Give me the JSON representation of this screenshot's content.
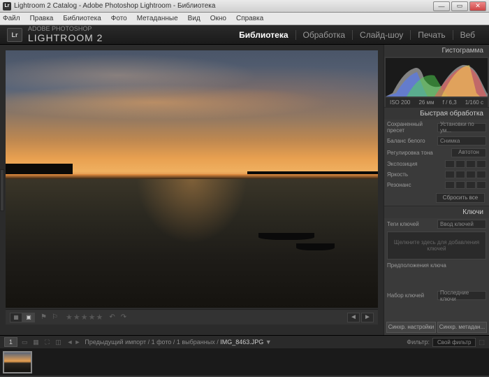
{
  "titlebar": {
    "text": "Lightroom 2 Catalog - Adobe Photoshop Lightroom - Библиотека",
    "logo": "Lr"
  },
  "menubar": {
    "items": [
      "Файл",
      "Правка",
      "Библиотека",
      "Фото",
      "Метаданные",
      "Вид",
      "Окно",
      "Справка"
    ]
  },
  "header": {
    "logo": "Lr",
    "brand_top": "ADOBE PHOTOSHOP",
    "brand_main": "LIGHTROOM 2",
    "modules": [
      "Библиотека",
      "Обработка",
      "Слайд-шоу",
      "Печать",
      "Веб"
    ]
  },
  "right": {
    "histogram_title": "Гистограмма",
    "histo_info": {
      "iso": "ISO 200",
      "focal": "26 мм",
      "aperture": "f / 6,3",
      "shutter": "1/160 с"
    },
    "quick_dev": {
      "title": "Быстрая обработка",
      "preset_label": "Сохраненный пресет",
      "preset_value": "Установки по ум...",
      "wb_label": "Баланс белого",
      "wb_value": "Снимка",
      "tone_label": "Регулировка тона",
      "auto_btn": "Автотон",
      "exposure_label": "Экспозиция",
      "clarity_label": "Яркость",
      "vibrance_label": "Резонанс",
      "reset_btn": "Сбросить все"
    },
    "keywords": {
      "title": "Ключи",
      "tags_label": "Теги ключей",
      "tags_value": "Ввод ключей",
      "placeholder": "Щелкните здесь для добавления ключей",
      "suggestions_label": "Предположения ключа",
      "set_label": "Набор ключей",
      "set_value": "Последние ключи"
    },
    "sync": {
      "settings": "Синхр. настройки",
      "metadata": "Синхр. метадан..."
    }
  },
  "filmstrip": {
    "page": "1",
    "crumb_prefix": "Предыдущий импорт / 1 фото / 1 выбранных /",
    "crumb_file": "IMG_8463.JPG",
    "filter_label": "Фильтр:",
    "filter_value": "Свой фильтр"
  }
}
